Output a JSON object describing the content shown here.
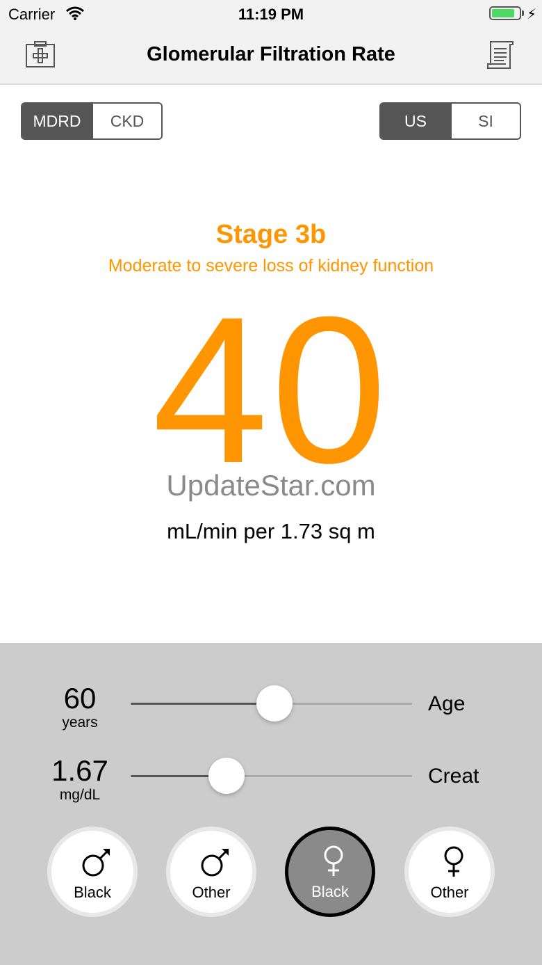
{
  "status": {
    "carrier": "Carrier",
    "time": "11:19 PM",
    "battery_level": 0.85
  },
  "nav": {
    "title": "Glomerular Filtration Rate",
    "left_icon": "medical-kit-icon",
    "right_icon": "report-icon"
  },
  "formula_segment": {
    "options": [
      "MDRD",
      "CKD"
    ],
    "selected": "MDRD"
  },
  "units_segment": {
    "options": [
      "US",
      "SI"
    ],
    "selected": "US"
  },
  "result": {
    "stage": "Stage 3b",
    "description": "Moderate to severe loss of kidney function",
    "value": "40",
    "unit": "mL/min per 1.73 sq m",
    "accent_color": "#ff9500"
  },
  "watermark": "UpdateStar.com",
  "sliders": [
    {
      "value": "60",
      "unit": "years",
      "label": "Age",
      "fraction": 0.51
    },
    {
      "value": "1.67",
      "unit": "mg/dL",
      "label": "Creat",
      "fraction": 0.34
    }
  ],
  "demographics": [
    {
      "symbol": "male-icon",
      "label": "Black",
      "selected": false
    },
    {
      "symbol": "male-icon",
      "label": "Other",
      "selected": false
    },
    {
      "symbol": "female-icon",
      "label": "Black",
      "selected": true
    },
    {
      "symbol": "female-icon",
      "label": "Other",
      "selected": false
    }
  ]
}
